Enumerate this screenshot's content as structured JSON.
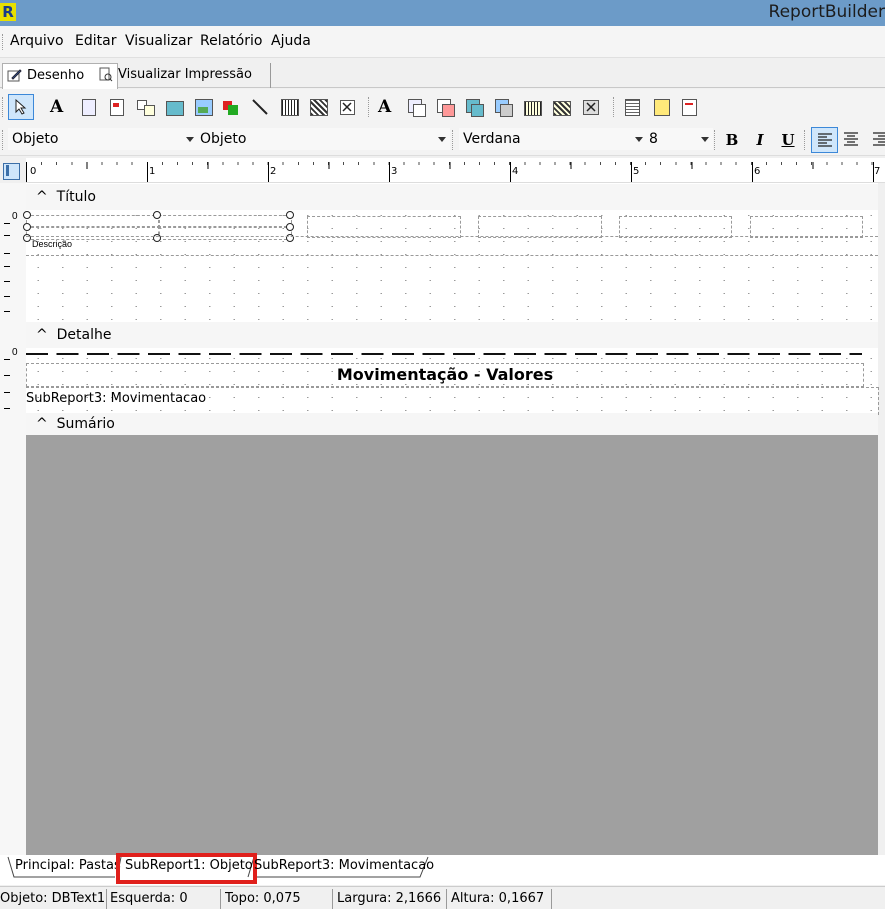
{
  "app": {
    "icon_letter": "R",
    "title": "ReportBuilder"
  },
  "menu": [
    "Arquivo",
    "Editar",
    "Visualizar",
    "Relatório",
    "Ajuda"
  ],
  "view_tabs": {
    "design": "Desenho",
    "preview": "Visualizar Impressão"
  },
  "format_toolbar": {
    "combo1": "Objeto",
    "combo2": "Objeto",
    "font": "Verdana",
    "size": "8",
    "bold": "B",
    "italic": "I",
    "underline": "U"
  },
  "ruler": {
    "numbers": [
      "0",
      "1",
      "2",
      "3",
      "4",
      "5",
      "6",
      "7"
    ]
  },
  "report": {
    "bands": {
      "title": "Título",
      "detail": "Detalhe",
      "summary": "Sumário"
    },
    "description_label": "Descrição",
    "detail_title": "Movimentação - Valores",
    "subreport_label": "SubReport3: Movimentacao"
  },
  "report_tabs": [
    "Principal: Pastas",
    "SubReport1: Objeto",
    "SubReport3: Movimentacao"
  ],
  "highlight_color": "#e0201c",
  "status": {
    "object": "Objeto: DBText1(",
    "left": "Esquerda: 0",
    "top": "Topo: 0,075",
    "width": "Largura: 2,1666",
    "height": "Altura: 0,1667"
  }
}
